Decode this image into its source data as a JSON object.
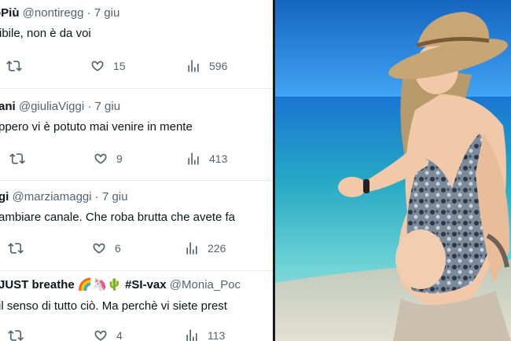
{
  "tweets": [
    {
      "name": "oPiù",
      "handle": "@nontiregg",
      "dot": "·",
      "date": "7 giu",
      "text": "ribile, non è da voi",
      "likes": "15",
      "views": "596"
    },
    {
      "name": "ani",
      "handle": "@giuliaViggi",
      "dot": "·",
      "date": "7 giu",
      "text": "ppero vi è potuto mai venire in mente",
      "likes": "9",
      "views": "413"
    },
    {
      "name": "gi",
      "handle": "@marziamaggi",
      "dot": "·",
      "date": "7 giu",
      "text": "ambiare canale. Che roba brutta che avete fa",
      "likes": "6",
      "views": "226"
    },
    {
      "name": "JUST breathe 🌈🦄🌵 #SI-vax",
      "handle": "@Monia_Poc",
      "dot": "",
      "date": "",
      "text": "il senso di tutto ciò. Ma perchè vi siete prest",
      "likes": "4",
      "views": "113"
    }
  ],
  "icons": {
    "retweet": "retweet-icon",
    "like": "heart-icon",
    "views": "views-chart-icon"
  },
  "colors": {
    "text": "#0f1419",
    "secondary": "#536471",
    "sea": "#3fc3cf",
    "sky": "#1e88e5"
  }
}
